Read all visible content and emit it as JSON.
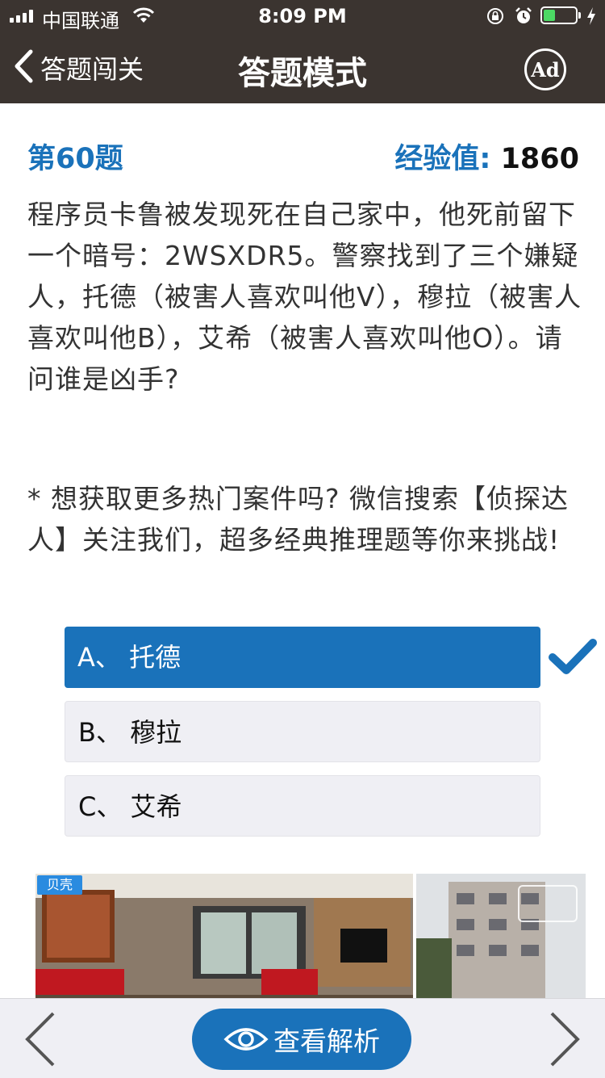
{
  "status_bar": {
    "carrier": "中国联通",
    "time": "8:09 PM"
  },
  "nav": {
    "back_label": "答题闯关",
    "title": "答题模式",
    "ad_label": "Ad"
  },
  "question": {
    "number_label": "第60题",
    "experience_label": "经验值:",
    "experience_value": "1860",
    "text": "程序员卡鲁被发现死在自己家中，他死前留下一个暗号：2WSXDR5。警察找到了三个嫌疑人，托德（被害人喜欢叫他V），穆拉（被害人喜欢叫他B），艾希（被害人喜欢叫他O）。请问谁是凶手?",
    "tip": "* 想获取更多热门案件吗? 微信搜索【侦探达人】关注我们，超多经典推理题等你来挑战!"
  },
  "options": [
    {
      "label": "A、 托德",
      "selected": true
    },
    {
      "label": "B、 穆拉",
      "selected": false
    },
    {
      "label": "C、 艾希",
      "selected": false
    }
  ],
  "ad_banner": {
    "logo_text": "贝壳"
  },
  "bottom_bar": {
    "analysis_label": "查看解析"
  },
  "colors": {
    "accent": "#1a72ba",
    "nav_bg": "#3b3430",
    "option_bg": "#efeff4"
  }
}
